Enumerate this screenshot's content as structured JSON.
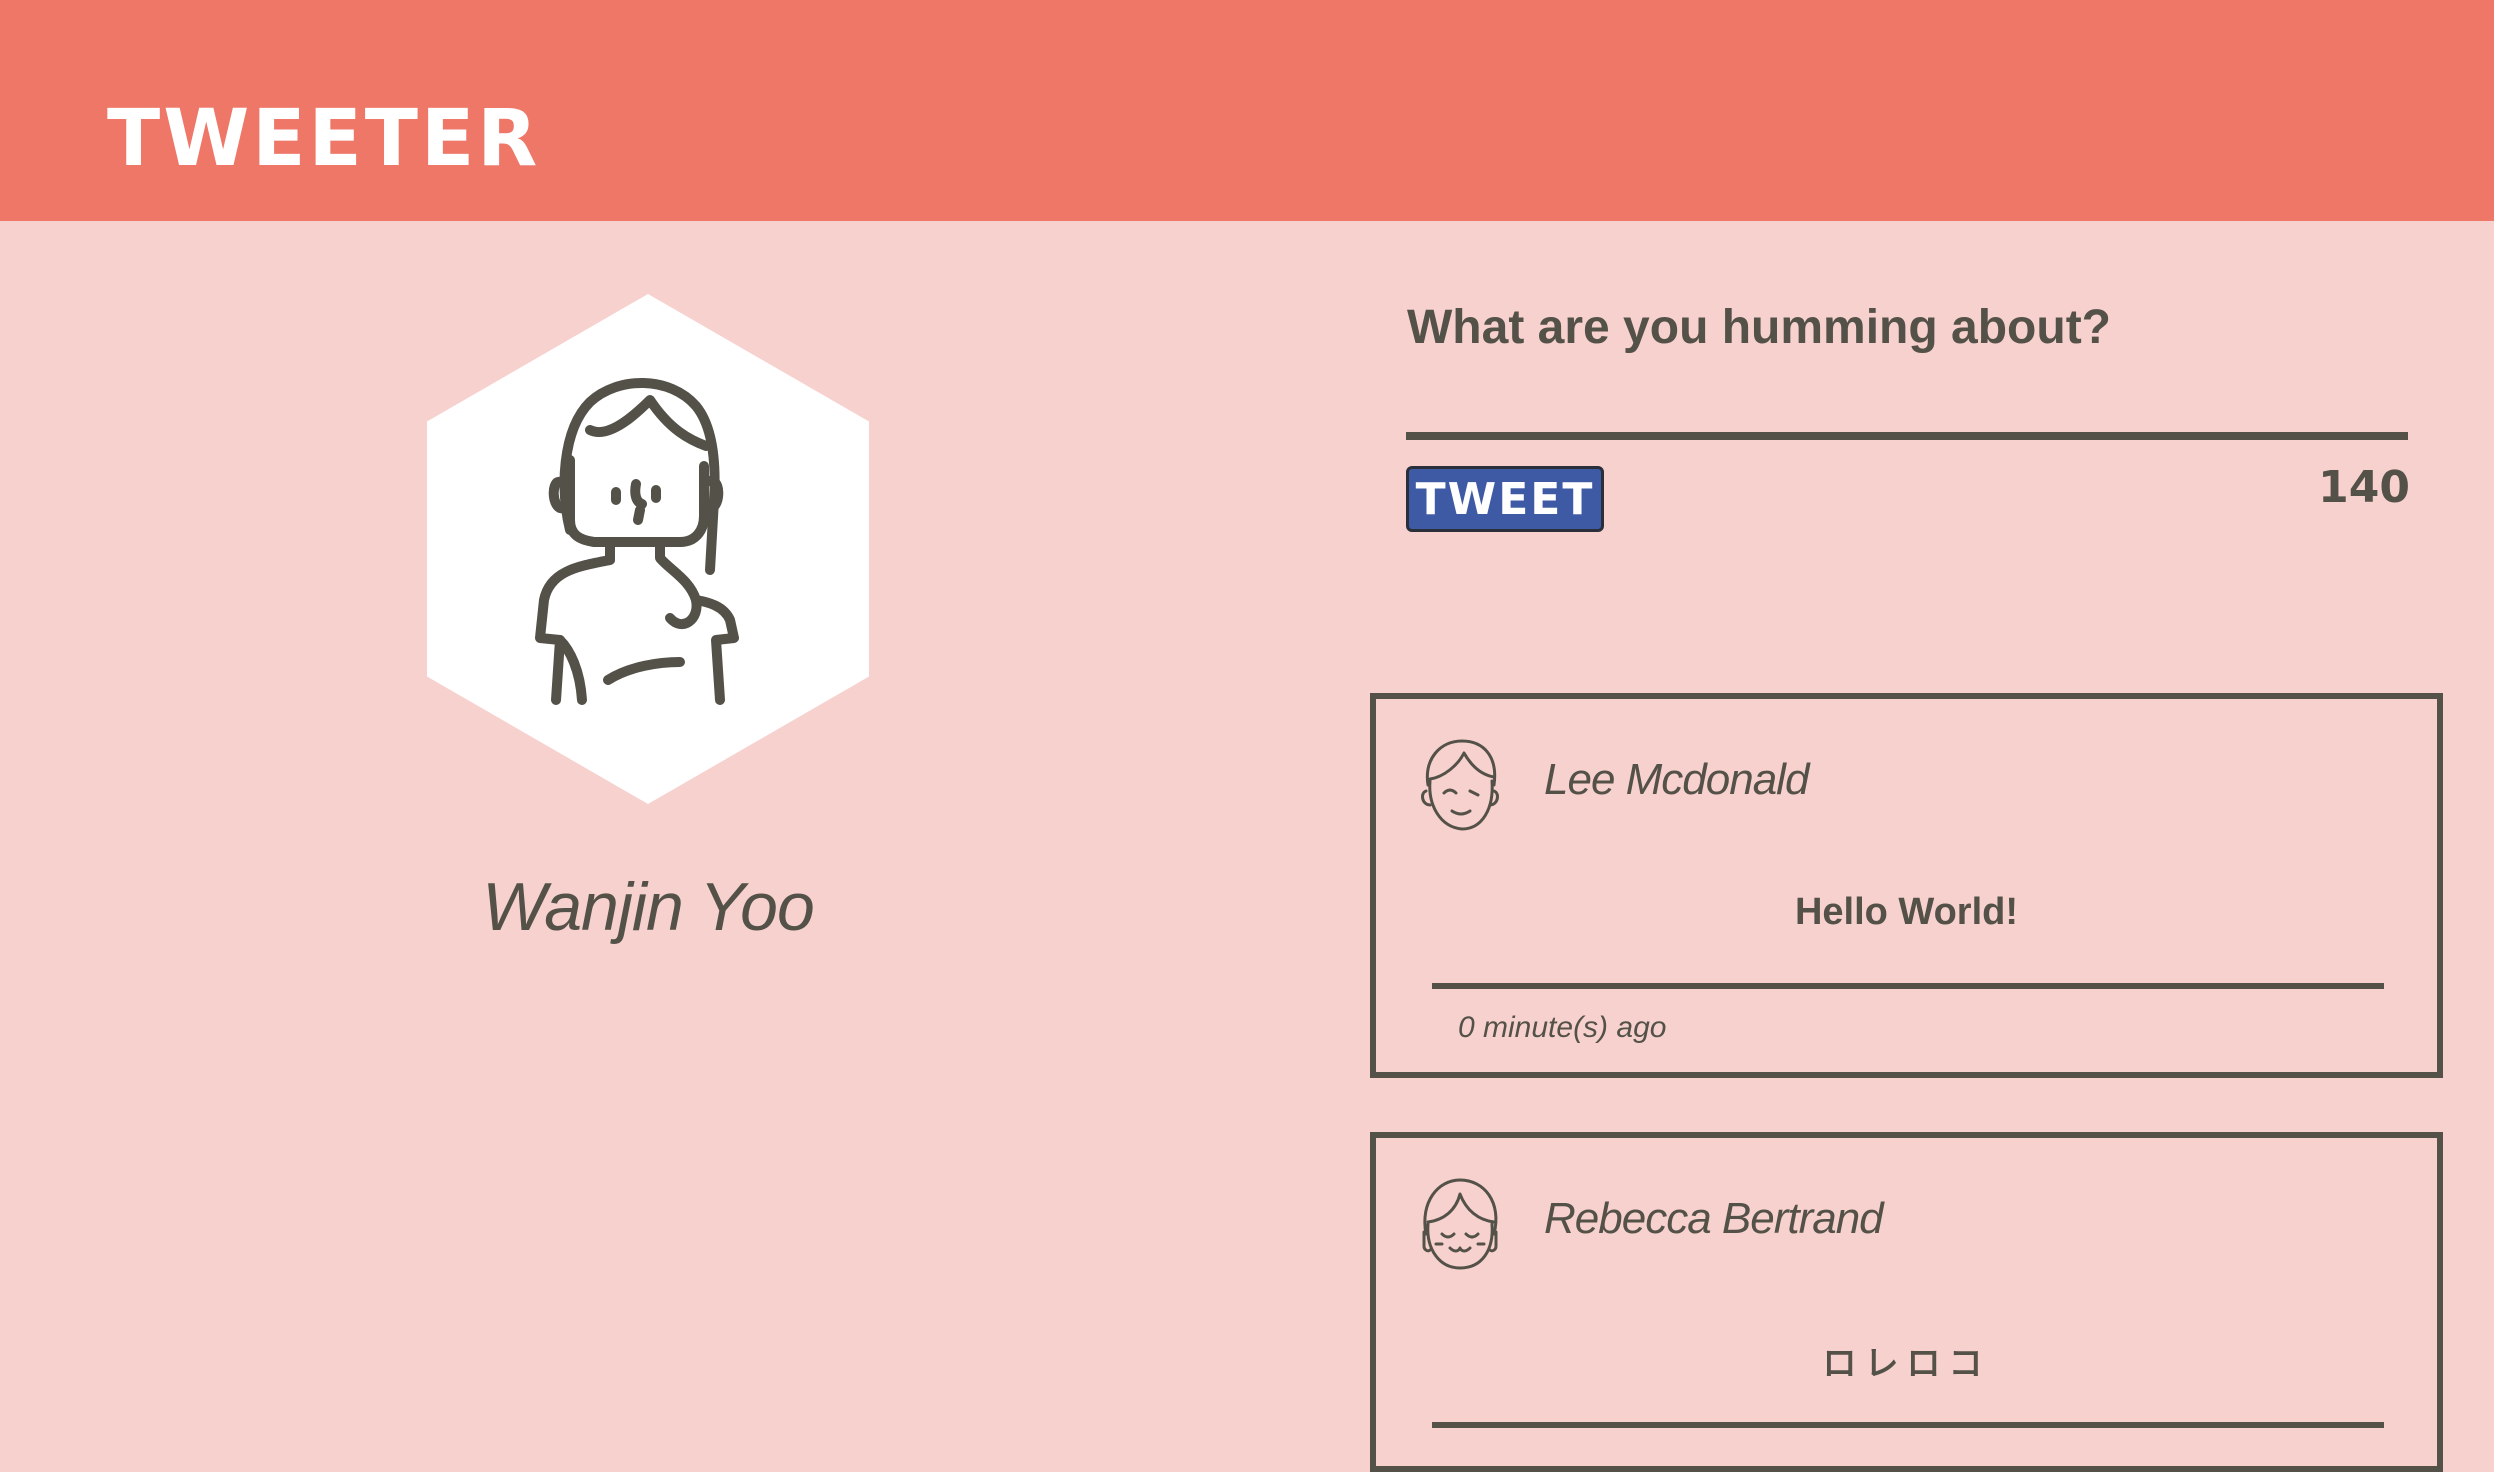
{
  "header": {
    "brand": "TWEETER"
  },
  "profile": {
    "name": "Wanjin Yoo",
    "avatar_icon": "woman-avatar-icon"
  },
  "composer": {
    "question": "What are you humming about?",
    "tweet_button": "TWEET",
    "char_count": "140"
  },
  "tweets": [
    {
      "user": "Lee Mcdonald",
      "avatar_icon": "boy-avatar-icon",
      "text": "Hello World!",
      "time": "0 minute(s) ago"
    },
    {
      "user": "Rebecca Bertrand",
      "avatar_icon": "girl-avatar-icon",
      "text": "ロレロコ"
    }
  ],
  "colors": {
    "header": "#ee7768",
    "background": "#f7d1cd",
    "text": "#545149",
    "button": "#3e5aa5"
  }
}
